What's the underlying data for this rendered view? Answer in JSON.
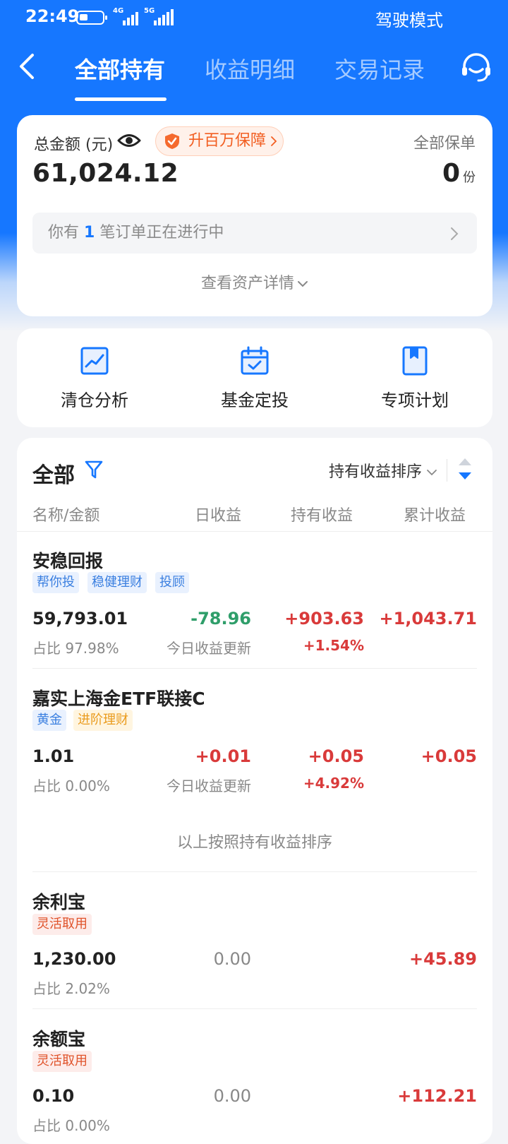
{
  "status_bar": {
    "time": "22:49",
    "net1": "4G",
    "net2": "5G",
    "drive_mode": "驾驶模式"
  },
  "nav": {
    "tabs": [
      {
        "label": "全部持有"
      },
      {
        "label": "收益明细"
      },
      {
        "label": "交易记录"
      }
    ]
  },
  "summary": {
    "total_label": "总金额 (元)",
    "total_value": "61,024.12",
    "guarantee_label": "升百万保障",
    "policy_label": "全部保单",
    "policy_count": "0",
    "policy_unit": "份",
    "order_prefix": "你有",
    "order_count": "1",
    "order_suffix": "笔订单正在进行中",
    "asset_detail": "查看资产详情"
  },
  "actions": [
    {
      "label": "清仓分析"
    },
    {
      "label": "基金定投"
    },
    {
      "label": "专项计划"
    }
  ],
  "list": {
    "title": "全部",
    "sort_label": "持有收益排序",
    "columns": [
      "名称/金额",
      "日收益",
      "持有收益",
      "累计收益"
    ],
    "sort_note": "以上按照持有收益排序",
    "items": [
      {
        "name": "安稳回报",
        "tags": [
          "帮你投",
          "稳健理财",
          "投顾"
        ],
        "amount": "59,793.01",
        "share": "占比 97.98%",
        "daily": "-78.96",
        "daily_note": "今日收益更新",
        "holding": "+903.63",
        "holding_rate": "+1.54%",
        "cumulative": "+1,043.71"
      },
      {
        "name": "嘉实上海金ETF联接C",
        "tags": [
          "黄金",
          "进阶理财"
        ],
        "amount": "1.01",
        "share": "占比 0.00%",
        "daily": "+0.01",
        "daily_note": "今日收益更新",
        "holding": "+0.05",
        "holding_rate": "+4.92%",
        "cumulative": "+0.05"
      },
      {
        "name": "余利宝",
        "tags": [
          "灵活取用"
        ],
        "amount": "1,230.00",
        "share": "占比 2.02%",
        "daily": "0.00",
        "cumulative": "+45.89"
      },
      {
        "name": "余额宝",
        "tags": [
          "灵活取用"
        ],
        "amount": "0.10",
        "share": "占比 0.00%",
        "daily": "0.00",
        "cumulative": "+112.21"
      }
    ]
  },
  "colors": {
    "brand_blue": "#1677ff",
    "profit_red": "#d93a3a",
    "loss_green": "#2f9e6a",
    "guarantee_orange": "#f25f22"
  }
}
